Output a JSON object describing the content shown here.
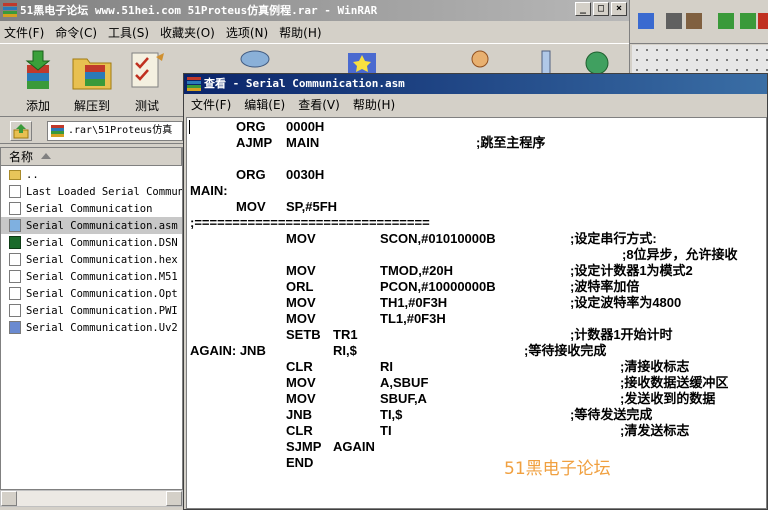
{
  "winrar": {
    "title": "51黑电子论坛 www.51hei.com 51Proteus仿真例程.rar - WinRAR",
    "menu": [
      "文件(F)",
      "命令(C)",
      "工具(S)",
      "收藏夹(O)",
      "选项(N)",
      "帮助(H)"
    ],
    "toolbar": [
      {
        "label": "添加",
        "icon": "add-archive-icon"
      },
      {
        "label": "解压到",
        "icon": "extract-to-icon"
      },
      {
        "label": "测试",
        "icon": "test-archive-icon"
      }
    ],
    "address": ".rar\\51Proteus仿真",
    "column_name": "名称",
    "files": [
      {
        "name": "..",
        "type": "folder"
      },
      {
        "name": "Last Loaded Serial Communi",
        "type": "file"
      },
      {
        "name": "Serial Communication",
        "type": "file"
      },
      {
        "name": "Serial Communication.asm",
        "type": "asm",
        "selected": true
      },
      {
        "name": "Serial Communication.DSN",
        "type": "dsn"
      },
      {
        "name": "Serial Communication.hex",
        "type": "file"
      },
      {
        "name": "Serial Communication.M51",
        "type": "file"
      },
      {
        "name": "Serial Communication.Opt",
        "type": "file"
      },
      {
        "name": "Serial Communication.PWI",
        "type": "file"
      },
      {
        "name": "Serial Communication.Uv2",
        "type": "uv2"
      }
    ]
  },
  "viewer": {
    "title": "查看 - Serial Communication.asm",
    "menu": [
      "文件(F)",
      "编辑(E)",
      "查看(V)",
      "帮助(H)"
    ],
    "code_lines": [
      {
        "cols": [
          "",
          "ORG",
          "0000H",
          "",
          ""
        ]
      },
      {
        "cols": [
          "",
          "AJMP",
          "MAIN",
          "",
          ";跳至主程序"
        ]
      },
      {
        "cols": [
          "",
          "",
          "",
          "",
          ""
        ]
      },
      {
        "cols": [
          "",
          "ORG",
          "0030H",
          "",
          ""
        ]
      },
      {
        "cols": [
          "MAIN:",
          "",
          "",
          "",
          ""
        ]
      },
      {
        "cols": [
          "",
          "MOV",
          "SP,#5FH",
          "",
          ""
        ]
      },
      {
        "cols": [
          ";===============================",
          "",
          "",
          "",
          ""
        ]
      },
      {
        "cols": [
          "",
          "",
          "MOV",
          "SCON,#01010000B",
          ";设定串行方式:"
        ]
      },
      {
        "cols": [
          "",
          "",
          "",
          "",
          ";8位异步，允许接收"
        ]
      },
      {
        "cols": [
          "",
          "",
          "MOV",
          "TMOD,#20H",
          ";设定计数器1为模式2"
        ]
      },
      {
        "cols": [
          "",
          "",
          "ORL",
          "PCON,#10000000B",
          ";波特率加倍"
        ]
      },
      {
        "cols": [
          "",
          "",
          "MOV",
          "TH1,#0F3H",
          ";设定波特率为4800"
        ]
      },
      {
        "cols": [
          "",
          "",
          "MOV",
          "TL1,#0F3H",
          ""
        ]
      },
      {
        "cols": [
          "",
          "",
          "SETB",
          "TR1",
          ";计数器1开始计时"
        ]
      },
      {
        "cols": [
          "AGAIN: JNB",
          "",
          "",
          "RI,$",
          ";等待接收完成"
        ]
      },
      {
        "cols": [
          "",
          "",
          "CLR",
          "RI",
          ";清接收标志"
        ]
      },
      {
        "cols": [
          "",
          "",
          "MOV",
          "A,SBUF",
          ";接收数据送缓冲区"
        ]
      },
      {
        "cols": [
          "",
          "",
          "MOV",
          "SBUF,A",
          ";发送收到的数据"
        ]
      },
      {
        "cols": [
          "",
          "",
          "JNB",
          "TI,$",
          ";等待发送完成"
        ]
      },
      {
        "cols": [
          "",
          "",
          "CLR",
          "TI",
          ";清发送标志"
        ]
      },
      {
        "cols": [
          "",
          "",
          "SJMP",
          "AGAIN",
          ""
        ]
      },
      {
        "cols": [
          "",
          "",
          "END",
          "",
          ""
        ]
      }
    ],
    "watermark": "51黑电子论坛"
  },
  "colors": {
    "active_title": "#0a246a",
    "inactive_title": "#808080",
    "watermark": "#f0a040"
  }
}
